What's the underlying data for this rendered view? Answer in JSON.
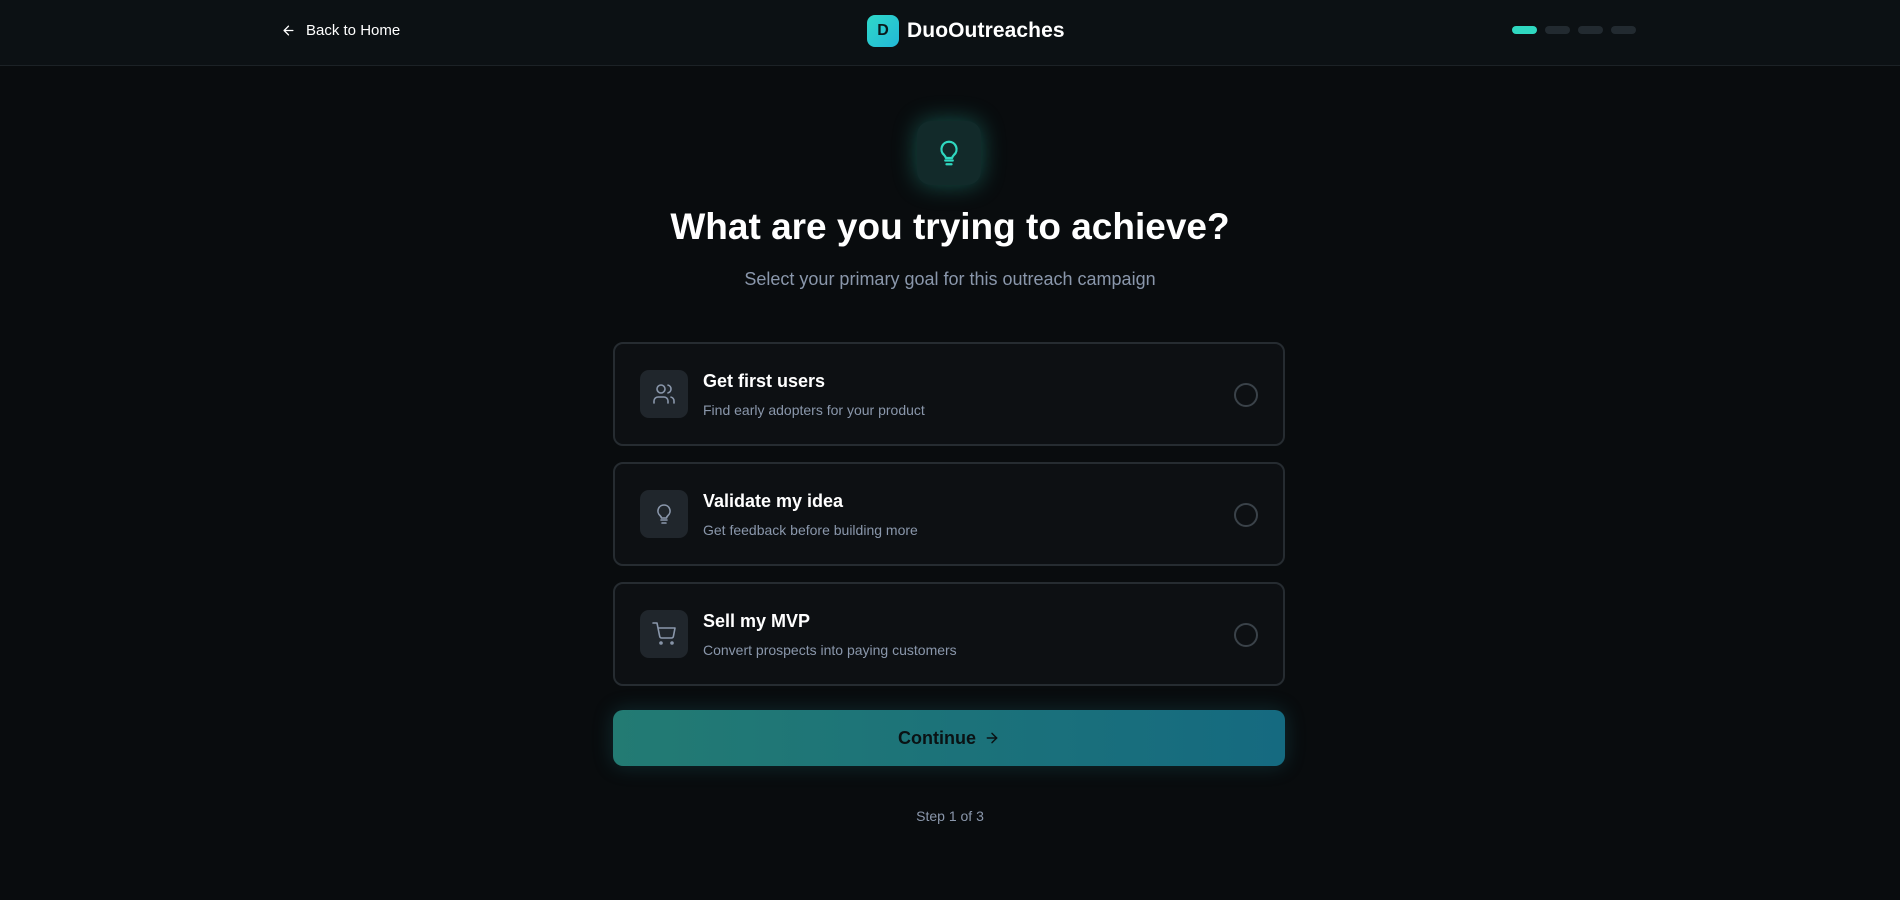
{
  "header": {
    "back_label": "Back to Home",
    "brand_initial": "D",
    "brand_name": "DuoOutreaches",
    "progress_steps": 4,
    "progress_active_index": 0
  },
  "hero": {
    "icon": "lightbulb-icon",
    "title": "What are you trying to achieve?",
    "subtitle": "Select your primary goal for this outreach campaign"
  },
  "options": [
    {
      "icon": "users-icon",
      "title": "Get first users",
      "description": "Find early adopters for your product",
      "selected": false
    },
    {
      "icon": "lightbulb-icon",
      "title": "Validate my idea",
      "description": "Get feedback before building more",
      "selected": false
    },
    {
      "icon": "shopping-cart-icon",
      "title": "Sell my MVP",
      "description": "Convert prospects into paying customers",
      "selected": false
    }
  ],
  "continue_label": "Continue",
  "step_label": "Step 1 of 3",
  "colors": {
    "accent": "#2fd8c0",
    "background": "#090c0e",
    "muted_text": "#8a97ab"
  }
}
